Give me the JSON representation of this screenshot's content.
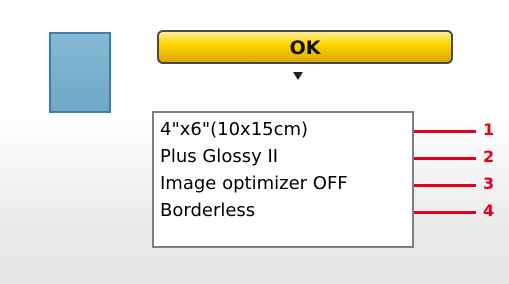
{
  "screen": {
    "ok_label": "OK",
    "settings": [
      {
        "text": "4\"x6\"(10x15cm)",
        "callout": "1"
      },
      {
        "text": "Plus Glossy II",
        "callout": "2"
      },
      {
        "text": "Image optimizer OFF",
        "callout": "3"
      },
      {
        "text": "Borderless",
        "callout": "4"
      }
    ]
  },
  "colors": {
    "ok_button": "#ffd800",
    "callout": "#e3001b",
    "tile": "#6fa8c7"
  }
}
